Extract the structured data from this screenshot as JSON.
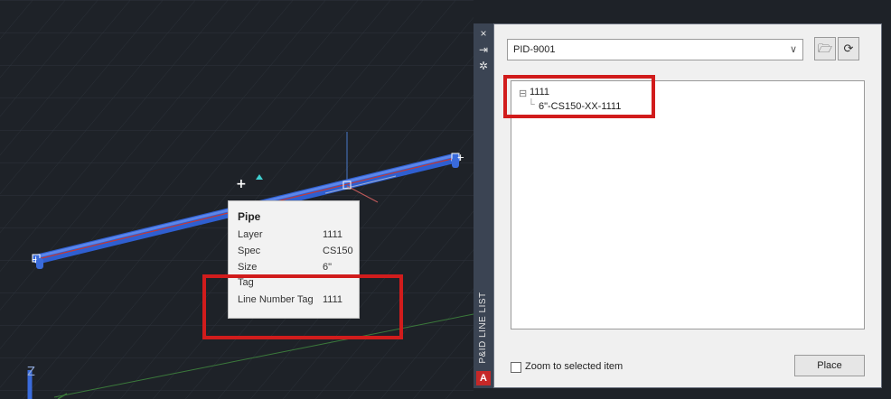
{
  "tooltip": {
    "title": "Pipe",
    "rows": [
      {
        "key": "Layer",
        "value": "1111"
      },
      {
        "key": "Spec",
        "value": "CS150"
      },
      {
        "key": "Size",
        "value": "6\""
      },
      {
        "key": "Tag",
        "value": ""
      },
      {
        "key": "Line Number Tag",
        "value": "1111"
      }
    ]
  },
  "viewport": {
    "axis_label": "Z"
  },
  "palette": {
    "title": "P&ID LINE LIST",
    "close_icon": "×",
    "autohide_icon": "⇥",
    "properties_icon": "✲",
    "logo": "A"
  },
  "panel": {
    "dropdown_value": "PID-9001",
    "dropdown_icon": "chevron-down-icon",
    "open_icon": "folder-open-icon",
    "refresh_icon": "refresh-icon",
    "tree": {
      "root": "1111",
      "child": "6\"-CS150-XX-1111"
    },
    "zoom_label": "Zoom to selected item",
    "place_label": "Place"
  },
  "colors": {
    "pipe": "#3a6bdb",
    "highlight": "#d11c1c",
    "canvas": "#1e2228"
  }
}
